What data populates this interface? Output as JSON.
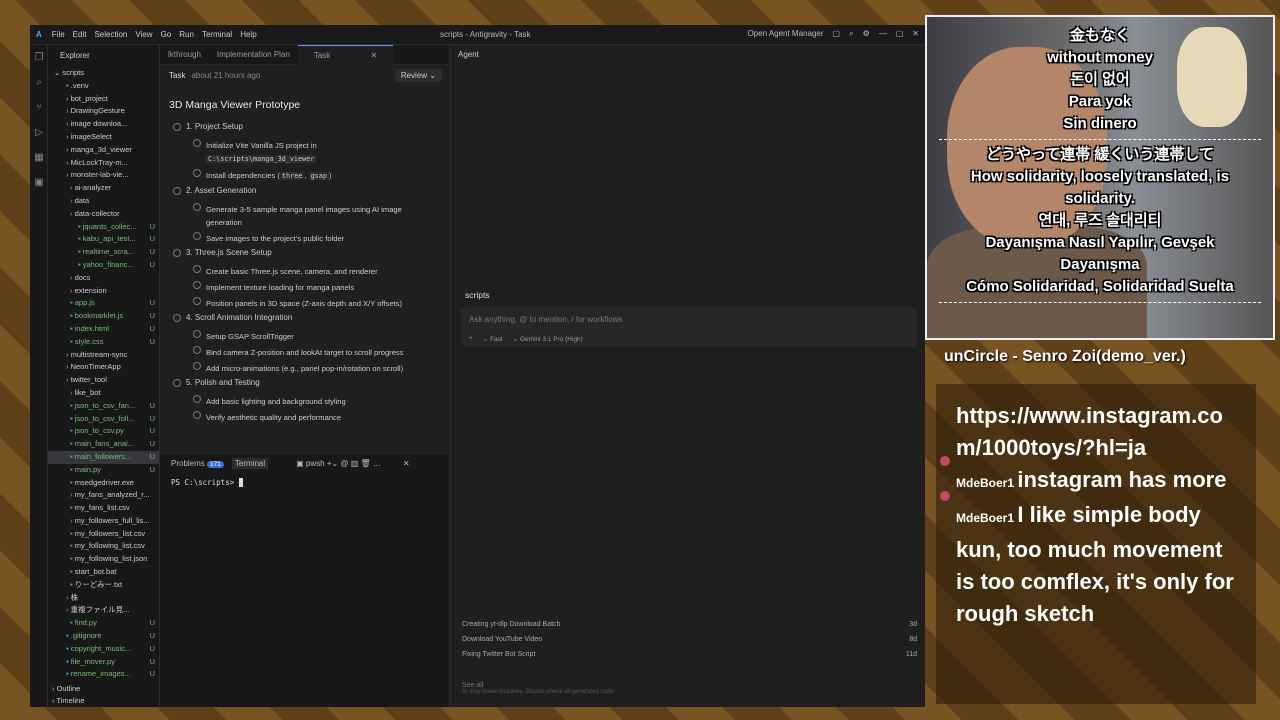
{
  "window": {
    "title": "scripts - Antigravity - Task",
    "menu": [
      "File",
      "Edit",
      "Selection",
      "View",
      "Go",
      "Run",
      "Terminal",
      "Help"
    ],
    "open_agent_manager": "Open Agent Manager"
  },
  "explorer": {
    "header": "Explorer",
    "root": "scripts",
    "items": [
      {
        "t": ".venv",
        "s": ""
      },
      {
        "t": "bot_project",
        "s": ""
      },
      {
        "t": "DrawingGesture",
        "s": ""
      },
      {
        "t": "image downloa...",
        "s": ""
      },
      {
        "t": "imageSelect",
        "s": ""
      },
      {
        "t": "manga_3d_viewer",
        "s": ""
      },
      {
        "t": "MicLockTray-m...",
        "s": ""
      },
      {
        "t": "monster-lab-vie...",
        "s": ""
      },
      {
        "t": "ai-analyzer",
        "s": ""
      },
      {
        "t": "data",
        "s": ""
      },
      {
        "t": "data-collector",
        "s": ""
      },
      {
        "t": "jquants_collec...",
        "s": "U"
      },
      {
        "t": "kabu_api_test...",
        "s": "U"
      },
      {
        "t": "realtime_scra...",
        "s": "U"
      },
      {
        "t": "yahoo_financ...",
        "s": "U"
      },
      {
        "t": "docs",
        "s": ""
      },
      {
        "t": "extension",
        "s": ""
      },
      {
        "t": "app.js",
        "s": "U"
      },
      {
        "t": "bookmarklet.js",
        "s": "U"
      },
      {
        "t": "index.html",
        "s": "U"
      },
      {
        "t": "style.css",
        "s": "U"
      },
      {
        "t": "multistream-sync",
        "s": ""
      },
      {
        "t": "NeonTimerApp",
        "s": ""
      },
      {
        "t": "twitter_tool",
        "s": ""
      },
      {
        "t": "like_bot",
        "s": ""
      },
      {
        "t": "json_to_csv_fan...",
        "s": "U"
      },
      {
        "t": "json_to_csv_foll...",
        "s": "U"
      },
      {
        "t": "json_to_csv.py",
        "s": "U"
      },
      {
        "t": "main_fans_anal...",
        "s": "U"
      },
      {
        "t": "main_followers...",
        "s": "U"
      },
      {
        "t": "main.py",
        "s": "U"
      },
      {
        "t": "msedgedriver.exe",
        "s": ""
      },
      {
        "t": "my_fans_analyzed_r...",
        "s": ""
      },
      {
        "t": "my_fans_list.csv",
        "s": ""
      },
      {
        "t": "my_followers_full_lis...",
        "s": ""
      },
      {
        "t": "my_followers_list.csv",
        "s": ""
      },
      {
        "t": "my_following_list.csv",
        "s": ""
      },
      {
        "t": "my_following_list.json",
        "s": ""
      },
      {
        "t": "start_bot.bat",
        "s": ""
      },
      {
        "t": "りーどみー.txt",
        "s": ""
      },
      {
        "t": "株",
        "s": ""
      },
      {
        "t": "重複ファイル見...",
        "s": ""
      },
      {
        "t": "find.py",
        "s": "U"
      },
      {
        "t": ".gitignore",
        "s": "U"
      },
      {
        "t": "copyright_music...",
        "s": "U"
      },
      {
        "t": "file_mover.py",
        "s": "U"
      },
      {
        "t": "rename_images...",
        "s": "U"
      }
    ],
    "outline": "Outline",
    "timeline": "Timeline"
  },
  "tabs": [
    "lkthrough",
    "Implementation Plan",
    "Task"
  ],
  "task": {
    "label": "Task",
    "time": "about 21 hours ago",
    "review": "Review",
    "title": "3D Manga Viewer Prototype",
    "sections": [
      {
        "h": "1. Project Setup",
        "items": [
          "Initialize Vite Vanilla JS project in",
          "Install dependencies ("
        ],
        "code1": "C:\\scripts\\manga_3d_viewer",
        "code2a": "three",
        "code2b": "gsap"
      },
      {
        "h": "2. Asset Generation",
        "items": [
          "Generate 3-5 sample manga panel images using AI image generation",
          "Save images to the project's public folder"
        ]
      },
      {
        "h": "3. Three.js Scene Setup",
        "items": [
          "Create basic Three.js scene, camera, and renderer",
          "Implement texture loading for manga panels",
          "Position panels in 3D space (Z-axis depth and X/Y offsets)"
        ]
      },
      {
        "h": "4. Scroll Animation Integration",
        "items": [
          "Setup GSAP ScrollTrigger",
          "Bind camera Z-position and lookAt target to scroll progress",
          "Add micro-animations (e.g., panel pop-in/rotation on scroll)"
        ]
      },
      {
        "h": "5. Polish and Testing",
        "items": [
          "Add basic lighting and background styling",
          "Verify aesthetic quality and performance"
        ]
      }
    ]
  },
  "panel": {
    "problems": "Problems",
    "problems_count": "171",
    "terminal": "Terminal",
    "shell": "pwsh",
    "prompt": "PS C:\\scripts> "
  },
  "agent": {
    "title": "Agent",
    "workspace": "scripts",
    "placeholder": "Ask anything, @ to mention, / for workflows",
    "mode": "Fast",
    "model": "Gemini 3.1 Pro (High)",
    "recent": [
      {
        "t": "Creating yt-dlp Download Batch",
        "d": "3d"
      },
      {
        "t": "Download YouTube Video",
        "d": "8d"
      },
      {
        "t": "Fixing Twitter Bot Script",
        "d": "11d"
      }
    ],
    "see_all": "See all",
    "disclaimer": "AI may make mistakes. Double-check all generated code."
  },
  "overlay": {
    "subs": [
      "金もなく",
      "without money",
      "돈이 없어",
      "Para yok",
      "Sin dinero",
      "どうやって連帯 緩くいう連帯して",
      "How solidarity, loosely translated, is",
      "solidarity.",
      "연대, 루즈 솔대리티",
      "Dayanışma Nasıl Yapılır, Gevşek",
      "Dayanışma",
      "Cómo Solidaridad, Solidaridad Suelta"
    ],
    "song": "unCircle - Senro Zoi(demo_ver.)",
    "chat": [
      {
        "name": "",
        "msg": "https://www.instagram.com/1000toys/?hl=ja"
      },
      {
        "name": "MdeBoer1",
        "msg": "instagram has more"
      },
      {
        "name": "MdeBoer1",
        "msg": "I like simple body kun, too much movement is too comflex, it's only for rough sketch"
      }
    ]
  }
}
